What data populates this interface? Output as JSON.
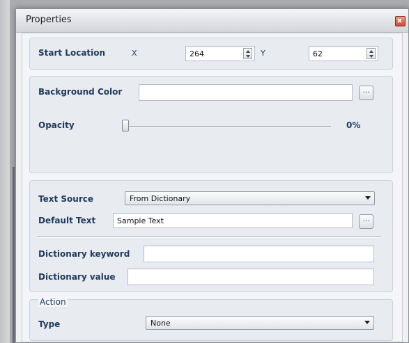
{
  "window": {
    "title": "Properties"
  },
  "start_location": {
    "label": "Start Location",
    "x_label": "X",
    "x_value": "264",
    "y_label": "Y",
    "y_value": "62"
  },
  "appearance": {
    "background_color_label": "Background Color",
    "background_color_value": "",
    "opacity_label": "Opacity",
    "opacity_value": "0%",
    "opacity_fraction": 0
  },
  "text": {
    "text_source_label": "Text Source",
    "text_source_value": "From Dictionary",
    "default_text_label": "Default Text",
    "default_text_value": "Sample Text",
    "dictionary_keyword_label": "Dictionary keyword",
    "dictionary_keyword_value": "",
    "dictionary_value_label": "Dictionary value",
    "dictionary_value_value": ""
  },
  "action": {
    "group_label": "Action",
    "type_label": "Type",
    "type_value": "None"
  },
  "buttons": {
    "ellipsis_label": "..."
  },
  "icons": {
    "close": "close-icon",
    "spin_up": "spin-up-icon",
    "spin_down": "spin-down-icon",
    "dropdown": "chevron-down-icon"
  }
}
